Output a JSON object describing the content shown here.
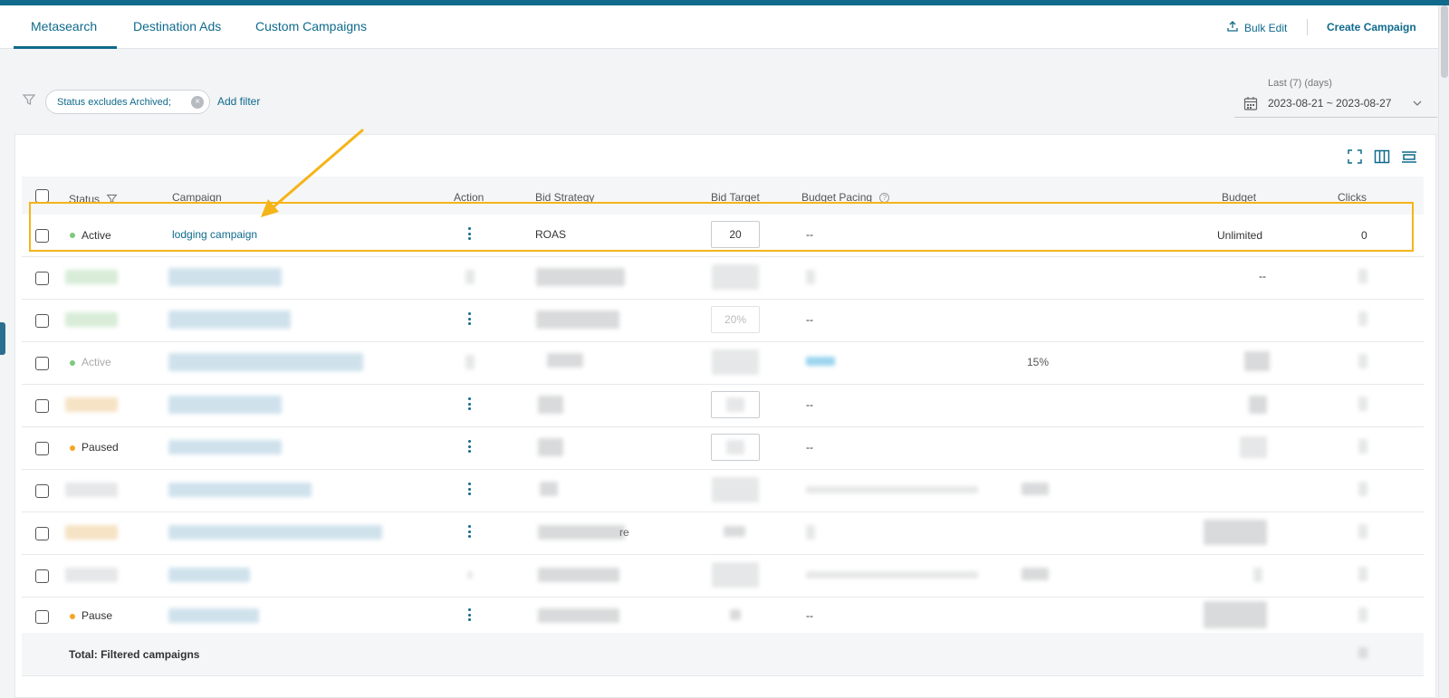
{
  "tabs": [
    {
      "label": "Metasearch",
      "active": true
    },
    {
      "label": "Destination Ads",
      "active": false
    },
    {
      "label": "Custom Campaigns",
      "active": false
    }
  ],
  "header_actions": {
    "bulk_edit": "Bulk Edit",
    "create_campaign": "Create Campaign"
  },
  "filters": {
    "chip": "Status excludes Archived;",
    "add_filter": "Add filter"
  },
  "date_range": {
    "caption": "Last (7) (days)",
    "value": "2023-08-21 ~ 2023-08-27"
  },
  "table": {
    "headers": {
      "status": "Status",
      "campaign": "Campaign",
      "action": "Action",
      "bid_strategy": "Bid Strategy",
      "bid_target": "Bid Target",
      "budget_pacing": "Budget Pacing",
      "budget": "Budget",
      "clicks": "Clicks"
    },
    "first_row": {
      "status": "Active",
      "campaign": "lodging campaign",
      "bid_strategy": "ROAS",
      "bid_target": "20",
      "budget_pacing": "--",
      "budget": "Unlimited",
      "clicks": "0"
    },
    "visible_fragments": {
      "row2_budget": "--",
      "row3_bid_target": "20%",
      "row3_pacing": "--",
      "row4_status": "Active",
      "row4_pacing_pct": "15%",
      "row5_pacing": "--",
      "row6_status": "Paused",
      "row6_pacing": "--",
      "row8_strategy_tail": "re",
      "row10_status": "Pause",
      "row10_pacing": "--"
    },
    "total_label": "Total: Filtered campaigns"
  },
  "colors": {
    "brand": "#0f6a8c",
    "active_dot": "#7fc97f",
    "paused_dot": "#f5a623",
    "highlight": "#f5b418"
  },
  "icons": {
    "bulk_edit": "upload-icon",
    "filter": "filter-icon",
    "calendar": "calendar-icon",
    "expand": "expand-icon",
    "columns": "columns-icon",
    "density": "density-icon"
  }
}
